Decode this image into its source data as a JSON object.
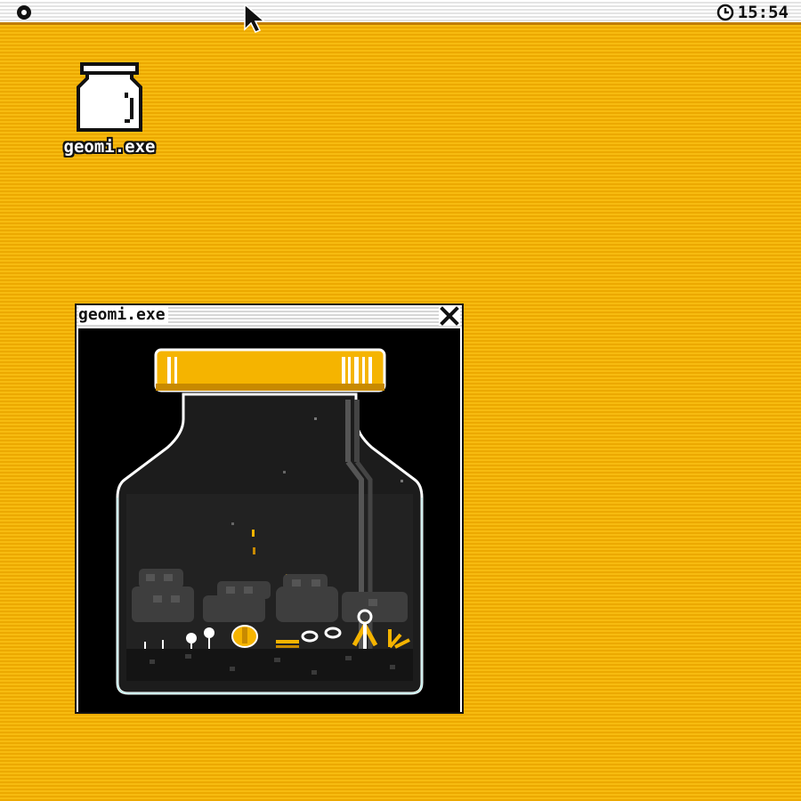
{
  "menubar": {
    "clock": "15:54",
    "icons": [
      "system-menu-icon",
      "clock-icon",
      "mouse-cursor-icon"
    ]
  },
  "desktop": {
    "icons": [
      {
        "label": "geomi.exe",
        "icon": "jar-icon"
      }
    ]
  },
  "window": {
    "title": "geomi.exe",
    "close_icon": "close-x-icon",
    "content": "terrarium-jar-scene"
  },
  "colors": {
    "desktop": "#f5b400",
    "accent": "#f5b400",
    "jar_lid": "#f5b400",
    "ink": "#111111",
    "window_bg": "#000000"
  }
}
